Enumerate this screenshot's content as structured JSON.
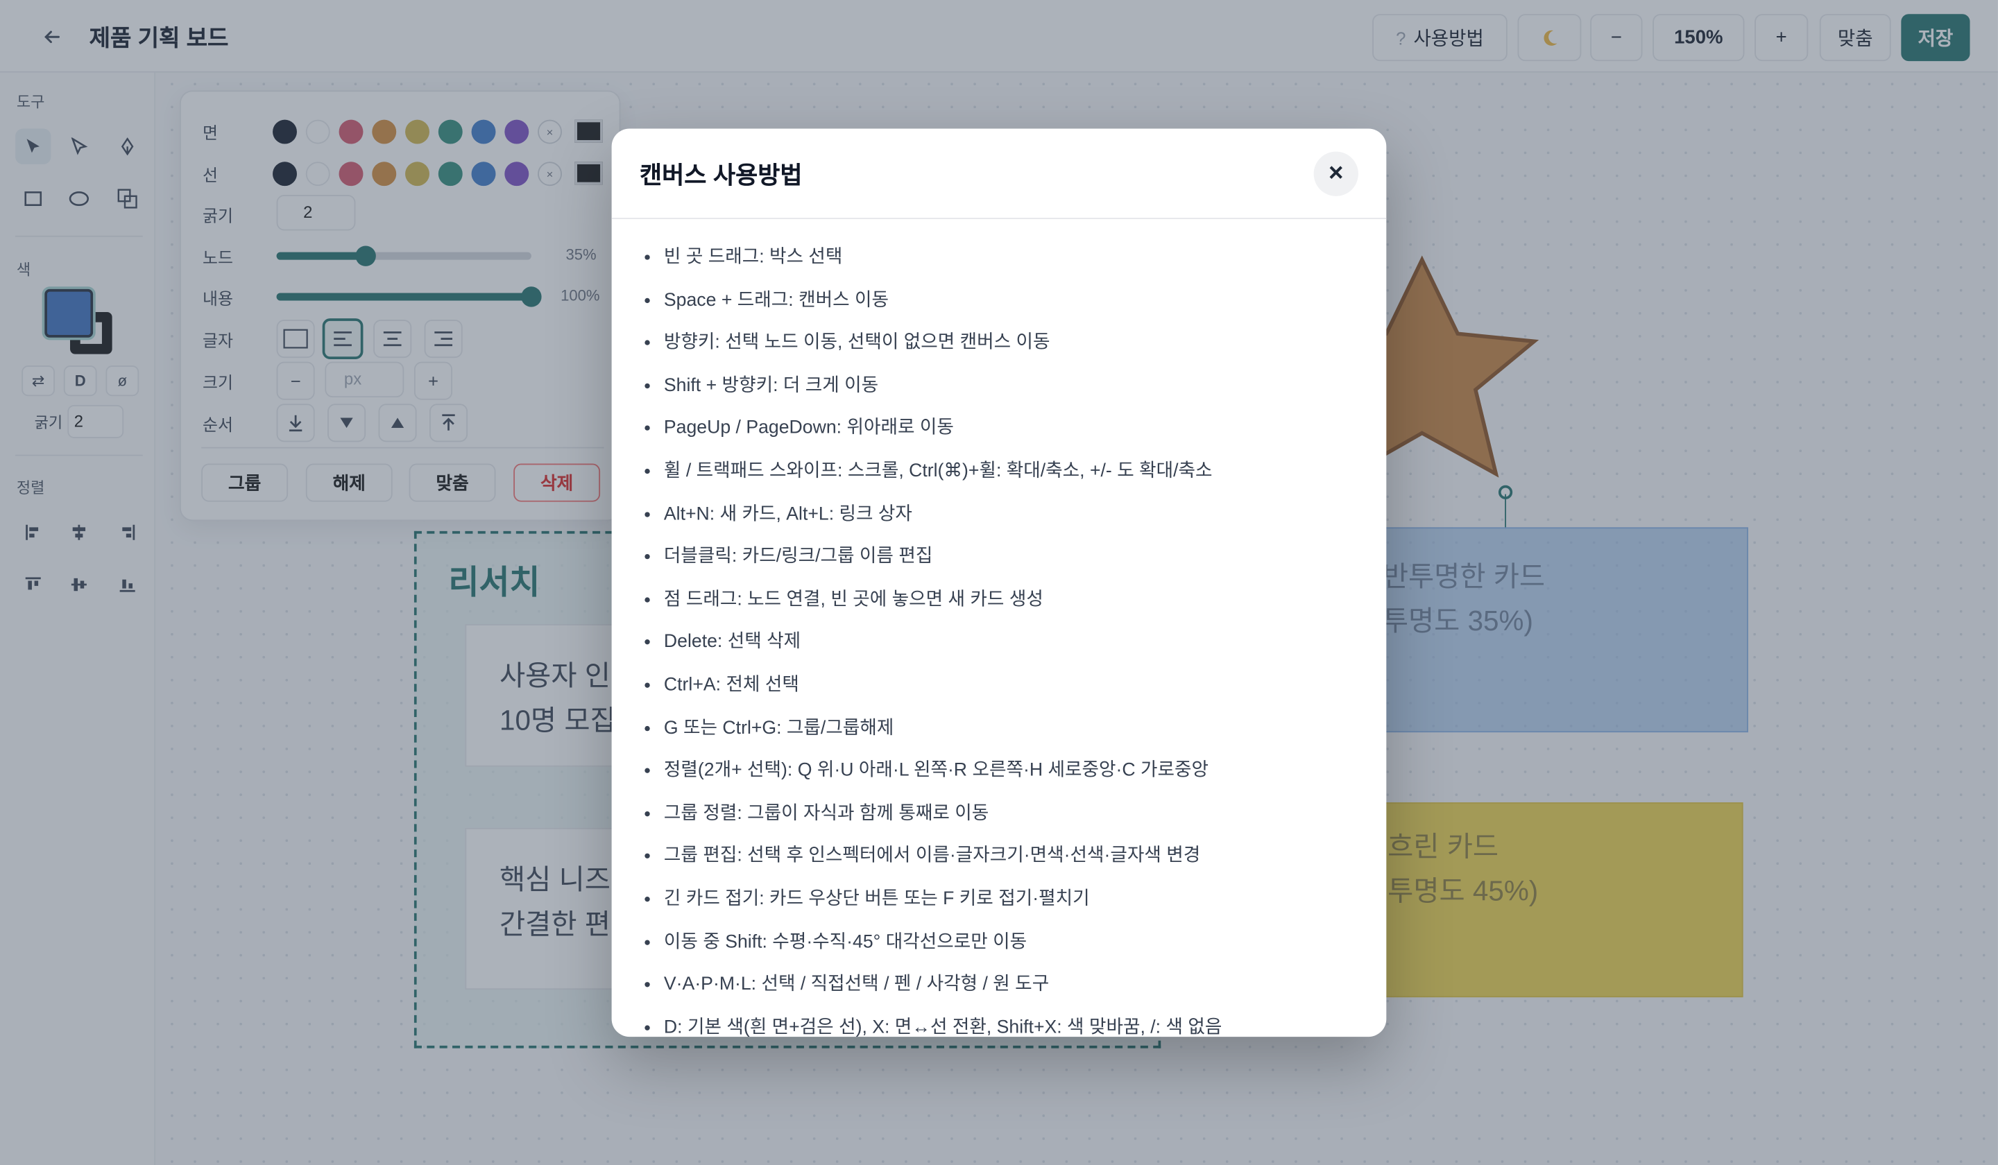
{
  "header": {
    "back_icon": "arrow-left-icon",
    "title": "제품 기획 보드",
    "help_label": "사용방법",
    "help_icon": "question-icon",
    "theme_icon": "moon-icon",
    "zoom_out": "−",
    "zoom_level": "150%",
    "zoom_in": "+",
    "fit_label": "맞춤",
    "save_label": "저장"
  },
  "left_panel": {
    "tools_label": "도구",
    "color_label": "색",
    "swap_label": "⇄",
    "default_label": "D",
    "none_label": "ø",
    "weight_label": "굵기",
    "weight_value": "2",
    "align_label": "정렬",
    "fill_color": "#3b6fbf",
    "stroke_color": "#111111"
  },
  "props": {
    "fill_label": "면",
    "stroke_label": "선",
    "weight_label": "굵기",
    "weight_value": "2",
    "node_label": "노드",
    "node_pct": "35%",
    "node_value": 0.35,
    "content_label": "내용",
    "content_pct": "100%",
    "content_value": 1.0,
    "text_label": "글자",
    "size_label": "크기",
    "size_placeholder": "px",
    "size_minus": "−",
    "size_plus": "+",
    "order_label": "순서",
    "group_btn": "그룹",
    "ungroup_btn": "해제",
    "fit_btn": "맞춤",
    "delete_btn": "삭제",
    "palette": [
      "#111827",
      "#ffffff",
      "#d4556b",
      "#d38a3a",
      "#cfb44a",
      "#2e8b78",
      "#3b78c9",
      "#7a4bc4"
    ],
    "none_mark": "×"
  },
  "canvas": {
    "group_title": "리서치",
    "card1_line1": "사용자 인",
    "card1_line2": "10명 모집",
    "card2_line1": "핵심 니즈:",
    "card2_line2": "간결한 편",
    "card3_line1": "반투명한 카드",
    "card3_line2": " 투명도 35%)",
    "card4_line1": "흐린 카드",
    "card4_line2": "투명도 45%)"
  },
  "modal": {
    "title": "캔버스 사용방법",
    "close_icon": "×",
    "tips": [
      "빈 곳 드래그: 박스 선택",
      "Space + 드래그: 캔버스 이동",
      "방향키: 선택 노드 이동, 선택이 없으면 캔버스 이동",
      "Shift + 방향키: 더 크게 이동",
      "PageUp / PageDown: 위아래로 이동",
      "휠 / 트랙패드 스와이프: 스크롤, Ctrl(⌘)+휠: 확대/축소, +/- 도 확대/축소",
      "Alt+N: 새 카드, Alt+L: 링크 상자",
      "더블클릭: 카드/링크/그룹 이름 편집",
      "점 드래그: 노드 연결, 빈 곳에 놓으면 새 카드 생성",
      "Delete: 선택 삭제",
      "Ctrl+A: 전체 선택",
      "G 또는 Ctrl+G: 그룹/그룹해제",
      "정렬(2개+ 선택): Q 위·U 아래·L 왼쪽·R 오른쪽·H 세로중앙·C 가로중앙",
      "그룹 정렬: 그룹이 자식과 함께 통째로 이동",
      "그룹 편집: 선택 후 인스펙터에서 이름·글자크기·면색·선색·글자색 변경",
      "긴 카드 접기: 카드 우상단 버튼 또는 F 키로 접기·펼치기",
      "이동 중 Shift: 수평·수직·45° 대각선으로만 이동",
      "V·A·P·M·L: 선택 / 직접선택 / 펜 / 사각형 / 원 도구",
      "D: 기본 색(흰 면+검은 선), X: 면↔선 전환, Shift+X: 색 맞바꿈, /: 색 없음"
    ]
  }
}
